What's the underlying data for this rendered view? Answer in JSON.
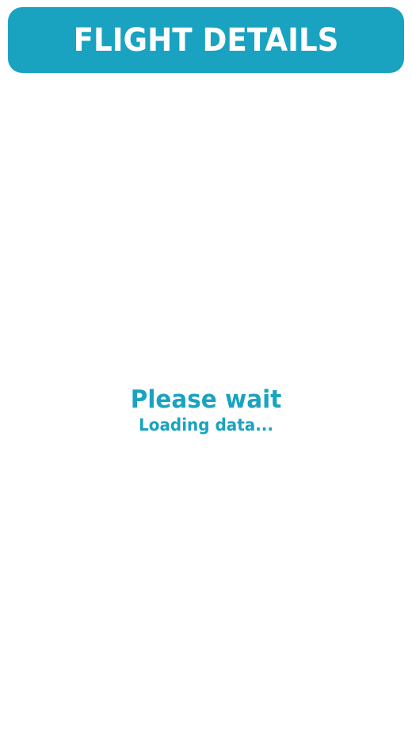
{
  "header": {
    "title": "FLIGHT DETAILS"
  },
  "loading": {
    "title": "Please wait",
    "subtitle": "Loading data..."
  },
  "colors": {
    "accent": "#1aa3c1",
    "background": "#ffffff",
    "header_text": "#ffffff"
  }
}
